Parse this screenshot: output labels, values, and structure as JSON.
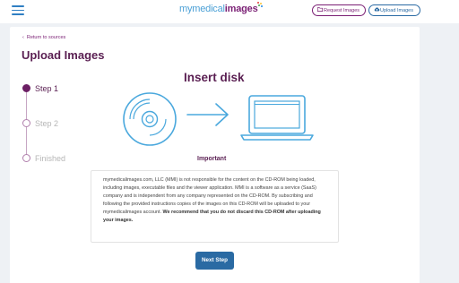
{
  "header": {
    "logo": {
      "part1": "my",
      "part2": "medical",
      "part3": "images"
    },
    "request_label": "Request Images",
    "upload_label": "Upload Images"
  },
  "main": {
    "back_link": "Return to sources",
    "page_title": "Upload Images",
    "steps": [
      {
        "label": "Step 1",
        "active": true
      },
      {
        "label": "Step 2",
        "active": false
      },
      {
        "label": "Finished",
        "active": false
      }
    ],
    "insert_title": "Insert disk",
    "important_label": "Important",
    "notice_text": "mymedicalimages.com, LLC (MMI) is not responsible for the content on the CD-ROM being loaded, including images, executable files and the viewer application. MMI is a software as a service (SaaS) company and is independent from any company represented on the CD-ROM. By subscribing and following the provided instructions copies of the images on this CD-ROM will be uploaded to your mymedicalimages account.",
    "notice_bold": "We recommend that you do not discard this CD-ROM after uploading your images.",
    "next_label": "Next Step"
  },
  "icons": {
    "menu": "hamburger-icon",
    "request": "folder-icon",
    "upload": "cloud-upload-icon",
    "back": "chevron-left-icon",
    "disk": "disk-icon",
    "arrow": "arrow-right-icon",
    "laptop": "laptop-icon"
  },
  "colors": {
    "brand_purple": "#5a1f52",
    "brand_blue": "#2a6aa3",
    "logo_light_blue": "#4ba0d6",
    "illustration_blue": "#4aa8dd",
    "page_background": "#eef1f5"
  }
}
